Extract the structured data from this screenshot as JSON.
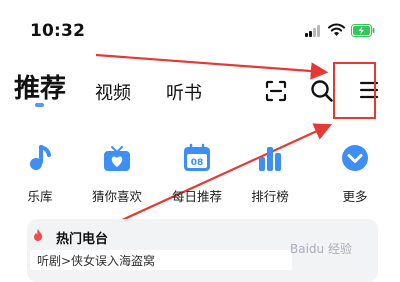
{
  "status_bar": {
    "time": "10:32"
  },
  "tabs": {
    "recommend": "推荐",
    "video": "视频",
    "audiobook": "听书"
  },
  "categories": [
    {
      "label": "乐库",
      "icon": "music-note-icon"
    },
    {
      "label": "猜你喜欢",
      "icon": "heart-tv-icon"
    },
    {
      "label": "每日推荐",
      "icon": "calendar-icon",
      "badge": "08"
    },
    {
      "label": "排行榜",
      "icon": "bar-chart-icon"
    },
    {
      "label": "更多",
      "icon": "chevron-down-circle-icon"
    }
  ],
  "hot_radio": {
    "title": "热门电台",
    "item": "听剧>侠女误入海盗窝"
  },
  "watermark": "Baidu 经验",
  "colors": {
    "accent": "#3d8ef5",
    "annotation": "#e53935",
    "battery": "#34c759"
  }
}
